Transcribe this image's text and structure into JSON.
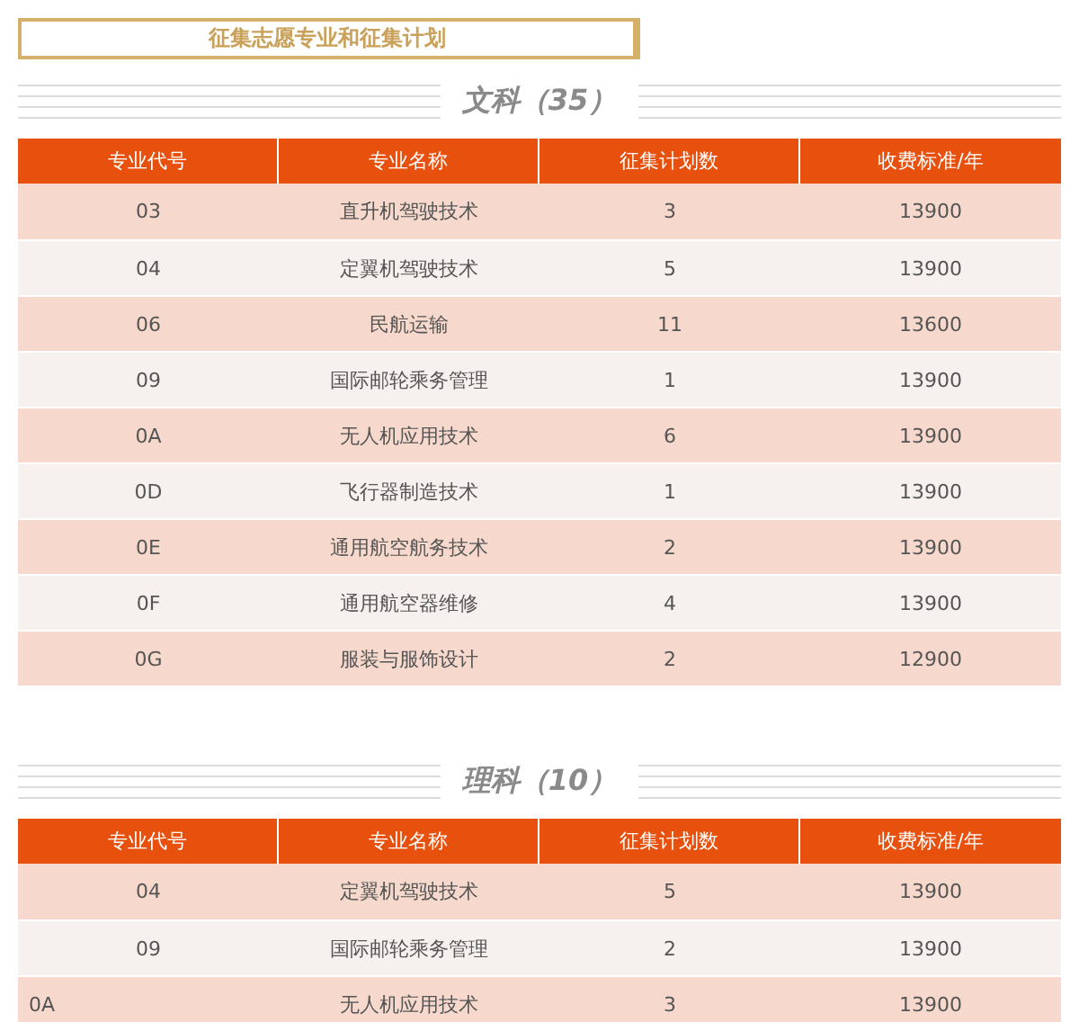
{
  "title": "征集志愿专业和征集计划",
  "sections": [
    {
      "heading": "文科（35）",
      "columns": [
        "专业代号",
        "专业名称",
        "征集计划数",
        "收费标准/年"
      ],
      "rows": [
        {
          "kind": "centered",
          "cells": [
            "03",
            "直升机驾驶技术",
            "3",
            "13900"
          ]
        },
        {
          "kind": "centered",
          "cells": [
            "04",
            "定翼机驾驶技术",
            "5",
            "13900"
          ]
        },
        {
          "kind": "centered",
          "cells": [
            "06",
            "民航运输",
            "11",
            "13600"
          ]
        },
        {
          "kind": "centered",
          "cells": [
            "09",
            "国际邮轮乘务管理",
            "1",
            "13900"
          ]
        },
        {
          "kind": "centered",
          "cells": [
            "0A",
            "无人机应用技术",
            "6",
            "13900"
          ]
        },
        {
          "kind": "centered",
          "cells": [
            "0D",
            "飞行器制造技术",
            "1",
            "13900"
          ]
        },
        {
          "kind": "centered",
          "cells": [
            "0E",
            "通用航空航务技术",
            "2",
            "13900"
          ]
        },
        {
          "kind": "centered",
          "cells": [
            "0F",
            "通用航空器维修",
            "4",
            "13900"
          ]
        },
        {
          "kind": "centered",
          "cells": [
            "0G",
            "服装与服饰设计",
            "2",
            "12900"
          ]
        }
      ]
    },
    {
      "heading": "理科（10）",
      "columns": [
        "专业代号",
        "专业名称",
        "征集计划数",
        "收费标准/年"
      ],
      "rows": [
        {
          "kind": "centered",
          "cells": [
            "04",
            "定翼机驾驶技术",
            "5",
            "13900"
          ]
        },
        {
          "kind": "centered",
          "cells": [
            "09",
            "国际邮轮乘务管理",
            "2",
            "13900"
          ]
        },
        {
          "kind": "leftcode",
          "cells": [
            "0A",
            "无人机应用技术",
            "3",
            "13900"
          ]
        }
      ]
    }
  ]
}
